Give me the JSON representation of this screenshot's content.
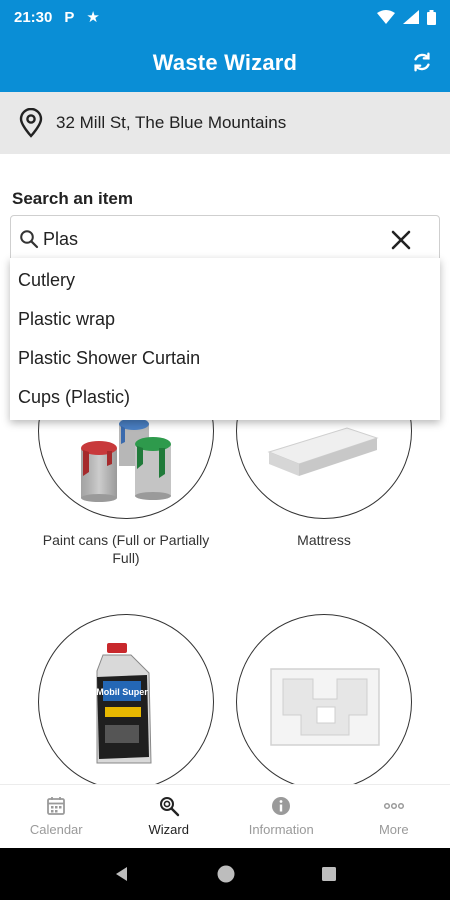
{
  "status_bar": {
    "time": "21:30",
    "notification_icons": [
      "parking-icon",
      "star-icon"
    ],
    "right_icons": [
      "wifi-icon",
      "signal-icon",
      "battery-icon"
    ]
  },
  "app_bar": {
    "title": "Waste Wizard",
    "action_icon": "refresh-icon"
  },
  "address": {
    "icon": "location-pin-icon",
    "text": "32 Mill St, The Blue Mountains"
  },
  "search": {
    "label": "Search an item",
    "value": "Plas",
    "clear_icon": "close-icon"
  },
  "suggestions": [
    {
      "label": "Cutlery"
    },
    {
      "label": "Plastic wrap"
    },
    {
      "label": "Plastic Shower Curtain"
    },
    {
      "label": "Cups (Plastic)"
    }
  ],
  "items": [
    {
      "name": "Paint cans (Full or Partially Full)",
      "image": "paint-cans"
    },
    {
      "name": "Mattress",
      "image": "mattress"
    },
    {
      "name": "",
      "image": "motor-oil-bottle",
      "bottle_text": "Mobil Super"
    },
    {
      "name": "",
      "image": "styrofoam-packaging"
    }
  ],
  "bottom_nav": {
    "active": "Wizard",
    "items": [
      {
        "label": "Calendar",
        "icon": "calendar-icon"
      },
      {
        "label": "Wizard",
        "icon": "wizard-search-icon"
      },
      {
        "label": "Information",
        "icon": "info-icon"
      },
      {
        "label": "More",
        "icon": "more-icon"
      }
    ]
  },
  "colors": {
    "primary": "#0a8ed6",
    "address_bg": "#e8e8e8",
    "nav_inactive": "#9a9a9a"
  }
}
